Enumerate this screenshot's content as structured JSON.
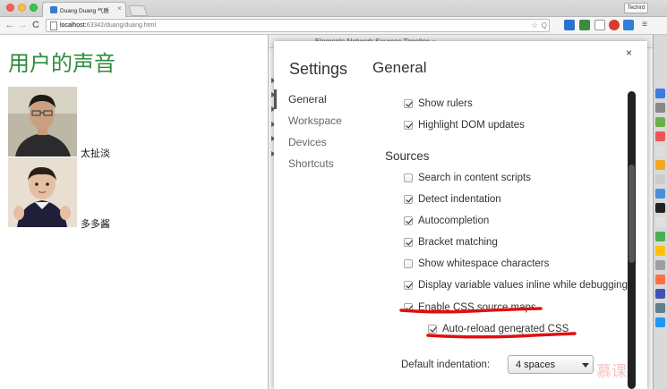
{
  "browser": {
    "tab_title": "Duang Duang 气质",
    "tab_close": "×",
    "profile_name": "Techird",
    "url_host": "localhost:",
    "url_path": "63342/duang/duang.html",
    "back_glyph": "←",
    "forward_glyph": "→",
    "reload_glyph": "C",
    "menu_glyph": "≡",
    "star_glyph": "☆",
    "search_glyph": "Q"
  },
  "page": {
    "title": "用户的声音",
    "profiles": [
      {
        "name": "太扯淡"
      },
      {
        "name": "多多酱"
      }
    ]
  },
  "devtools": {
    "tab_strip_text": "Elements  Network  Sources  Timeline  »"
  },
  "settings": {
    "title": "Settings",
    "close_glyph": "×",
    "section_title": "General",
    "nav": [
      "General",
      "Workspace",
      "Devices",
      "Shortcuts"
    ],
    "options_top": [
      {
        "label": "Show rulers",
        "checked": true
      },
      {
        "label": "Highlight DOM updates",
        "checked": true
      }
    ],
    "sources_heading": "Sources",
    "sources_options": [
      {
        "label": "Search in content scripts",
        "checked": false
      },
      {
        "label": "Detect indentation",
        "checked": true
      },
      {
        "label": "Autocompletion",
        "checked": true
      },
      {
        "label": "Bracket matching",
        "checked": true
      },
      {
        "label": "Show whitespace characters",
        "checked": false
      },
      {
        "label": "Display variable values inline while debugging",
        "checked": true
      },
      {
        "label": "Enable CSS source maps",
        "checked": true
      }
    ],
    "sub_option": {
      "label": "Auto-reload generated CSS",
      "checked": true
    },
    "indentation_label": "Default indentation:",
    "indentation_value": "4 spaces"
  },
  "watermark": "慕课",
  "colors": {
    "page_title": "#2e8b3d",
    "annotation_red": "#e01010"
  }
}
